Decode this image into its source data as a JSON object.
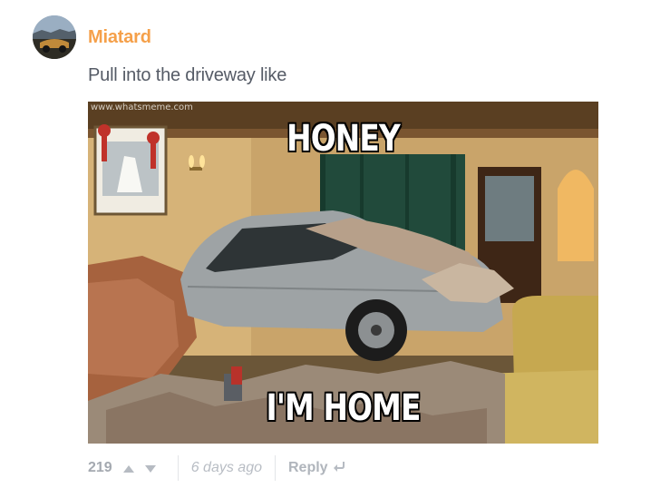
{
  "comment": {
    "author": "Miatard",
    "message": "Pull into the driveway like",
    "meme": {
      "watermark": "www.whatsmeme.com",
      "top_caption": "HONEY",
      "bottom_caption": "I'M HOME"
    },
    "footer": {
      "vote_count": "219",
      "upvote_icon": "triangle-up-icon",
      "downvote_icon": "triangle-down-icon",
      "timestamp": "6 days ago",
      "reply_label": "Reply",
      "reply_icon": "reply-arrow-icon"
    }
  },
  "colors": {
    "author": "#f5a04a",
    "message": "#555b66",
    "footer_text": "#b3b8bf",
    "divider": "#e3e5e8"
  }
}
